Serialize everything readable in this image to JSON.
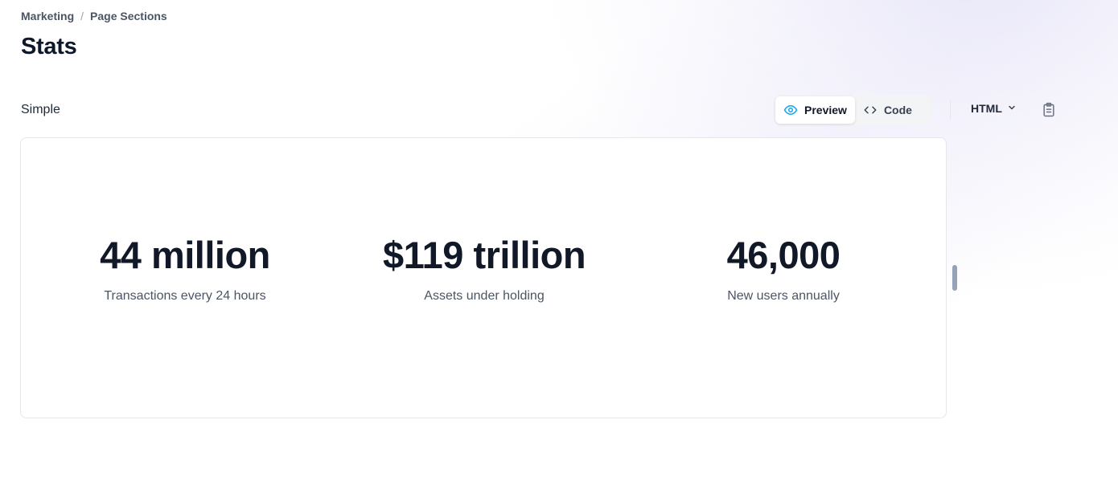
{
  "breadcrumb": {
    "items": [
      "Marketing",
      "Page Sections"
    ],
    "separator": "/"
  },
  "page": {
    "title": "Stats"
  },
  "section": {
    "label": "Simple"
  },
  "toolbar": {
    "preview_label": "Preview",
    "code_label": "Code",
    "language": "HTML",
    "preview_active": true
  },
  "stats": [
    {
      "value": "44 million",
      "description": "Transactions every 24 hours"
    },
    {
      "value": "$119 trillion",
      "description": "Assets under holding"
    },
    {
      "value": "46,000",
      "description": "New users annually"
    }
  ],
  "colors": {
    "accent": "#0ea5e9",
    "text": "#111827",
    "muted": "#4b5563"
  },
  "icons": {
    "preview": "eye-icon",
    "code": "code-icon",
    "dropdown": "chevron-down-icon",
    "copy": "clipboard-icon"
  }
}
